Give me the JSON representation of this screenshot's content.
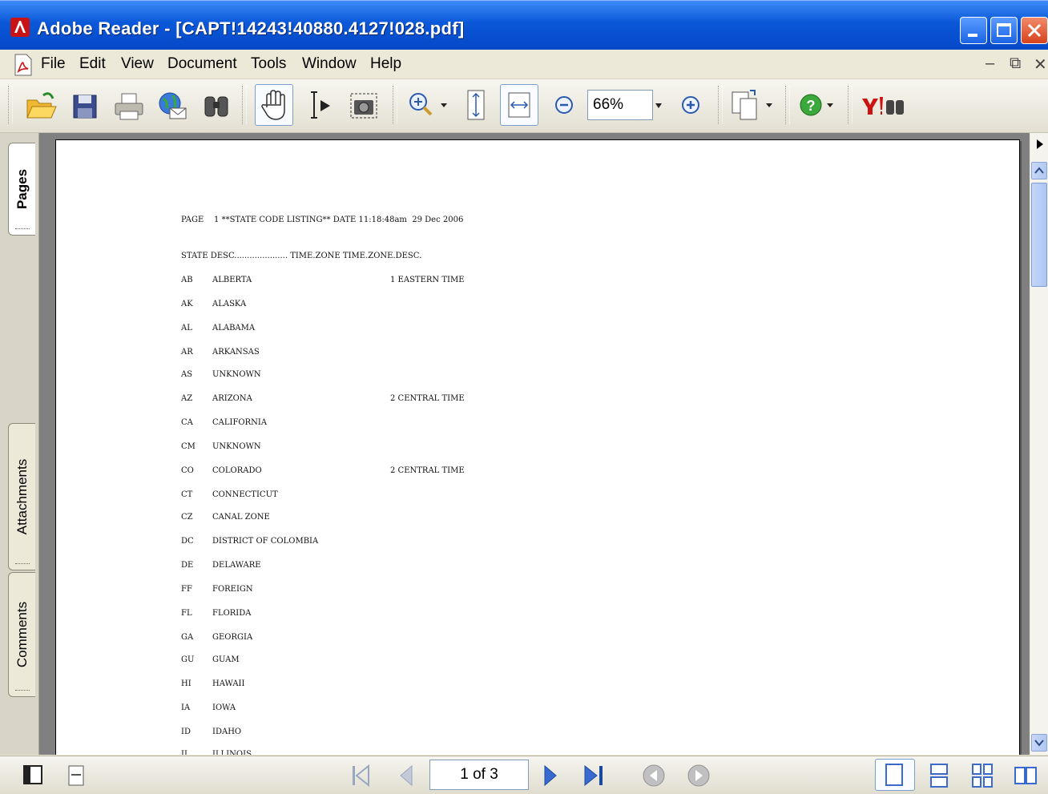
{
  "window": {
    "title": "Adobe Reader - [CAPT!14243!40880.4127!028.pdf]"
  },
  "menubar": {
    "items": [
      "File",
      "Edit",
      "View",
      "Document",
      "Tools",
      "Window",
      "Help"
    ]
  },
  "toolbar": {
    "zoom_value": "66%",
    "buttons": [
      "open-icon",
      "save-icon",
      "print-icon",
      "email-icon",
      "search-icon",
      "hand-tool-icon",
      "select-text-icon",
      "snapshot-icon",
      "zoom-in-tool-icon",
      "fit-page-icon",
      "fit-width-icon",
      "zoom-out-icon",
      "zoom-plus-icon",
      "page-options-icon",
      "help-icon",
      "yahoo-search-icon"
    ],
    "accent_color": "#cc1111"
  },
  "side_tabs": {
    "pages": "Pages",
    "attachments": "Attachments",
    "comments": "Comments"
  },
  "document": {
    "header": "PAGE    1 **STATE CODE LISTING** DATE 11:18:48am  29 Dec 2006",
    "columns": "STATE DESC..................... TIME.ZONE TIME.ZONE.DESC.",
    "rows": [
      {
        "code": "AB",
        "desc": "ALBERTA",
        "zone": "1 EASTERN TIME"
      },
      {
        "code": "AK",
        "desc": "ALASKA",
        "zone": ""
      },
      {
        "code": "AL",
        "desc": "ALABAMA",
        "zone": ""
      },
      {
        "code": "AR",
        "desc": "ARKANSAS",
        "zone": ""
      },
      {
        "code": "AS",
        "desc": "UNKNOWN",
        "zone": ""
      },
      {
        "code": "AZ",
        "desc": "ARIZONA",
        "zone": "2 CENTRAL TIME"
      },
      {
        "code": "CA",
        "desc": "CALIFORNIA",
        "zone": ""
      },
      {
        "code": "CM",
        "desc": "UNKNOWN",
        "zone": ""
      },
      {
        "code": "CO",
        "desc": "COLORADO",
        "zone": "2 CENTRAL TIME"
      },
      {
        "code": "CT",
        "desc": "CONNECTICUT",
        "zone": ""
      },
      {
        "code": "CZ",
        "desc": "CANAL ZONE",
        "zone": ""
      },
      {
        "code": "DC",
        "desc": "DISTRICT OF COLOMBIA",
        "zone": ""
      },
      {
        "code": "DE",
        "desc": "DELAWARE",
        "zone": ""
      },
      {
        "code": "FF",
        "desc": "FOREIGN",
        "zone": ""
      },
      {
        "code": "FL",
        "desc": "FLORIDA",
        "zone": ""
      },
      {
        "code": "GA",
        "desc": "GEORGIA",
        "zone": ""
      },
      {
        "code": "GU",
        "desc": "GUAM",
        "zone": ""
      },
      {
        "code": "HI",
        "desc": "HAWAII",
        "zone": ""
      },
      {
        "code": "IA",
        "desc": "IOWA",
        "zone": ""
      },
      {
        "code": "ID",
        "desc": "IDAHO",
        "zone": ""
      },
      {
        "code": "IL",
        "desc": "ILLINOIS",
        "zone": ""
      }
    ]
  },
  "statusbar": {
    "page_indicator": "1 of 3"
  }
}
